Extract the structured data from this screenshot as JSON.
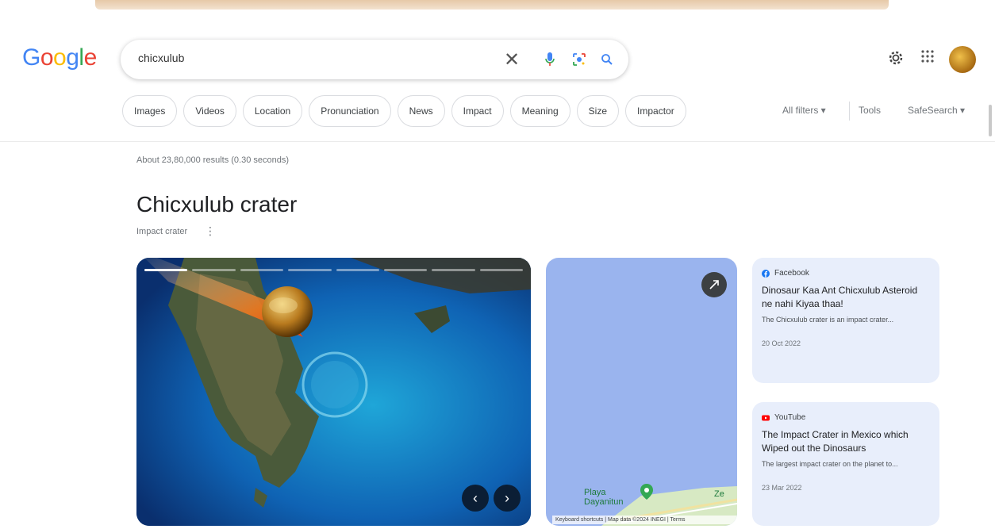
{
  "logo": {
    "letters": [
      "G",
      "o",
      "o",
      "g",
      "l",
      "e"
    ]
  },
  "search": {
    "query": "chicxulub"
  },
  "chips": [
    "Images",
    "Videos",
    "Location",
    "Pronunciation",
    "News",
    "Impact",
    "Meaning",
    "Size",
    "Impactor"
  ],
  "filters": {
    "all_filters": "All filters ▾",
    "tools": "Tools",
    "safesearch": "SafeSearch ▾"
  },
  "result_stats": "About 23,80,000 results (0.30 seconds)",
  "knowledge_panel": {
    "title": "Chicxulub crater",
    "subtitle": "Impact crater",
    "more": "⋮"
  },
  "carousel": {
    "prev": "‹",
    "next": "›"
  },
  "map": {
    "place_line1": "Playa",
    "place_line2": "Dayanitun",
    "edge_label": "Ze",
    "attribution": "Keyboard shortcuts  |  Map data ©2024 INEGI  |  Terms"
  },
  "cards": [
    {
      "source": "Facebook",
      "source_color": "#1877f2",
      "title": "Dinosaur Kaa Ant Chicxulub Asteroid ne nahi Kiyaa thaa!",
      "snippet": "The Chicxulub crater is an impact crater...",
      "date": "20 Oct 2022"
    },
    {
      "source": "YouTube",
      "source_color": "#ff0000",
      "title": "The Impact Crater in Mexico which Wiped out the Dinosaurs",
      "snippet": "The largest impact crater on the planet to...",
      "date": "23 Mar 2022"
    }
  ],
  "icons": {
    "clear": "✕",
    "mic": "mic-icon",
    "lens": "lens-icon",
    "search": "search-icon",
    "settings": "gear-icon",
    "apps": "apps-grid-icon"
  }
}
